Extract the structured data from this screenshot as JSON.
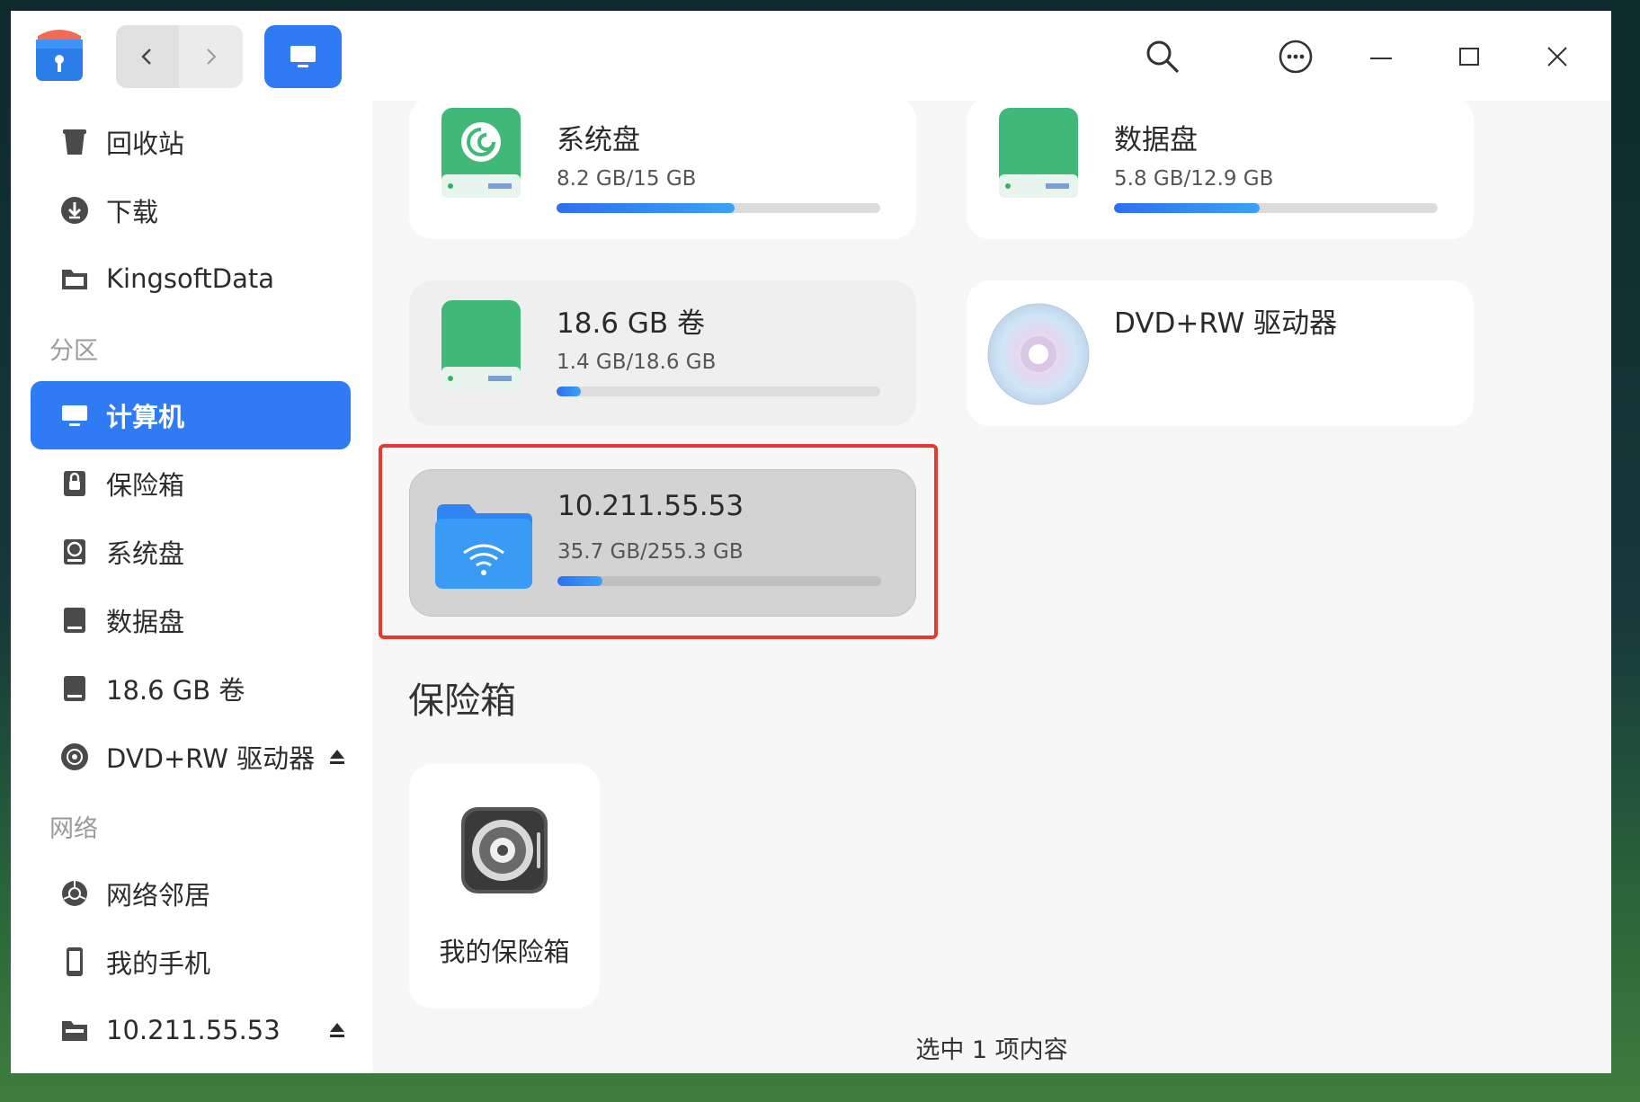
{
  "toolbar": {
    "app_icon": "file-manager-icon",
    "back_icon": "chevron-left-icon",
    "forward_icon": "chevron-right-icon",
    "view_icon": "computer-icon",
    "search_icon": "search-icon",
    "menu_icon": "more-icon",
    "minimize_icon": "minimize-icon",
    "maximize_icon": "maximize-icon",
    "close_icon": "close-icon",
    "accent": "#2f7bf5"
  },
  "sidebar": {
    "items_top": [
      {
        "label": "回收站",
        "icon": "trash-icon"
      },
      {
        "label": "下载",
        "icon": "download-icon"
      },
      {
        "label": "KingsoftData",
        "icon": "folder-icon"
      }
    ],
    "group_partitions": "分区",
    "partitions": [
      {
        "label": "计算机",
        "icon": "computer-icon",
        "active": true
      },
      {
        "label": "保险箱",
        "icon": "vault-icon"
      },
      {
        "label": "系统盘",
        "icon": "system-disk-icon"
      },
      {
        "label": "数据盘",
        "icon": "disk-icon"
      },
      {
        "label": "18.6 GB 卷",
        "icon": "disk-icon"
      },
      {
        "label": "DVD+RW 驱动器",
        "icon": "disc-icon",
        "eject": true
      }
    ],
    "group_network": "网络",
    "network": [
      {
        "label": "网络邻居",
        "icon": "network-icon"
      },
      {
        "label": "我的手机",
        "icon": "phone-icon"
      },
      {
        "label": "10.211.55.53",
        "icon": "network-share-icon",
        "eject": true
      }
    ]
  },
  "main": {
    "drives": [
      {
        "name": "系统盘",
        "size": "8.2 GB/15 GB",
        "fill": 0.55
      },
      {
        "name": "数据盘",
        "size": "5.8 GB/12.9 GB",
        "fill": 0.45
      },
      {
        "name": "18.6 GB 卷",
        "size": "1.4 GB/18.6 GB",
        "fill": 0.075
      },
      {
        "name": "DVD+RW 驱动器"
      },
      {
        "name": "10.211.55.53",
        "size": "35.7 GB/255.3 GB",
        "fill": 0.14
      }
    ],
    "vault_section_title": "保险箱",
    "vault_item": "我的保险箱"
  },
  "status_bar": "选中 1 项内容"
}
